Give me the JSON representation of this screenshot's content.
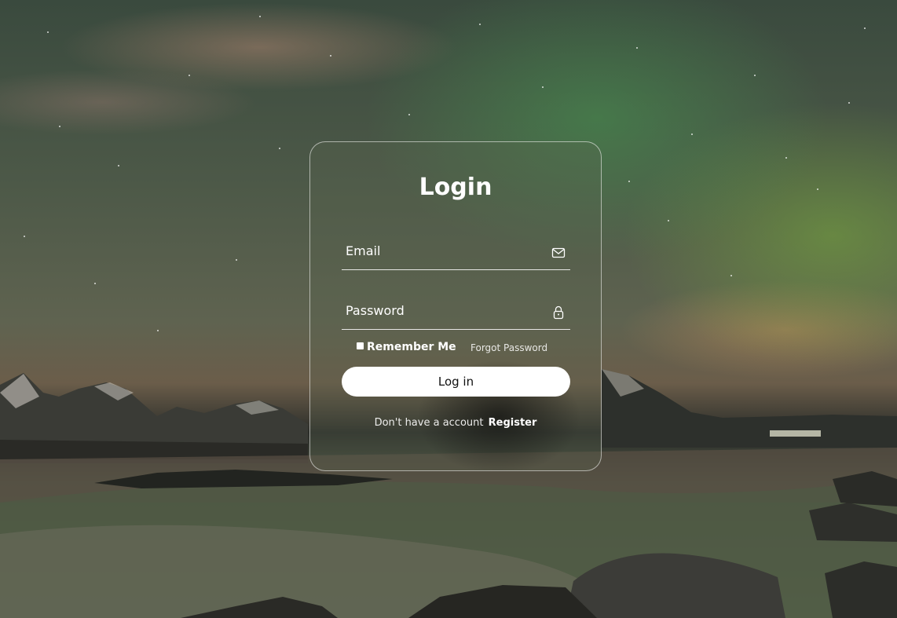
{
  "login": {
    "title": "Login",
    "email_placeholder": "Email",
    "password_placeholder": "Password",
    "remember_label": "Remember Me",
    "forgot_label": "Forgot Password",
    "submit_label": "Log in",
    "register_prompt": "Don't have a account",
    "register_label": "Register",
    "email_icon": "envelope-icon",
    "password_icon": "lock-icon"
  },
  "colors": {
    "text": "#ffffff",
    "button_bg": "#ffffff",
    "button_text": "#111111"
  }
}
